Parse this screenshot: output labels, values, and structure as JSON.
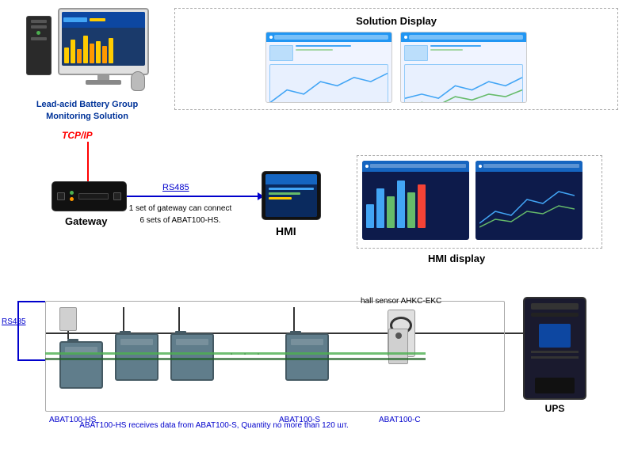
{
  "header": {
    "product_label": "Lead-acid Battery Group\nMonitoring Solution",
    "solution_display_title": "Solution Display"
  },
  "middle": {
    "tcpip_label": "TCP/IP",
    "rs485_label": "RS485",
    "gateway_label": "Gateway",
    "gateway_info": "1 set of gateway can\nconnect 6 sets of\nABAT100-HS.",
    "hmi_label": "HMI",
    "hmi_display_label": "HMI display"
  },
  "bottom": {
    "rs485_label": "RS485",
    "abat100_hs_label": "ABAT100-HS",
    "abat100_s_label": "ABAT100-S",
    "abat100_c_label": "ABAT100-C",
    "hall_sensor_label": "hall sensor AHKC-EKC",
    "ups_label": "UPS",
    "center_text": "ABAT100-HS receives data from ABAT100-S,\nQuantity no more than 120 шт."
  },
  "icons": {
    "monitor_bars": [
      20,
      30,
      25,
      40,
      35,
      28
    ],
    "gw_leds": [
      "#4caf50",
      "#ff9800",
      "#f44336"
    ],
    "colors": {
      "blue_link": "#0000cc",
      "red_tcp": "#cc0000",
      "green_wire": "#4caf50",
      "dark_bg": "#1a1a2e"
    }
  }
}
